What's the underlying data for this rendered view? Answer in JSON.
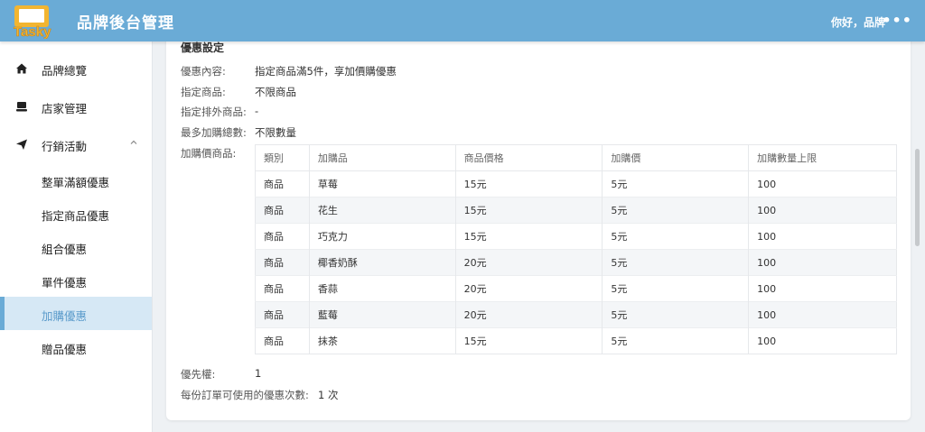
{
  "header": {
    "logo_text": "Tasky",
    "title": "品牌後台管理",
    "greeting": "你好，品牌",
    "more": "•••"
  },
  "sidebar": {
    "items": [
      {
        "label": "品牌總覽",
        "icon": "home-icon"
      },
      {
        "label": "店家管理",
        "icon": "store-icon"
      },
      {
        "label": "行銷活動",
        "icon": "send-icon",
        "expanded": true
      }
    ],
    "sub_items": [
      {
        "label": "整單滿額優惠"
      },
      {
        "label": "指定商品優惠"
      },
      {
        "label": "組合優惠"
      },
      {
        "label": "單件優惠"
      },
      {
        "label": "加購優惠",
        "active": true
      },
      {
        "label": "贈品優惠"
      }
    ]
  },
  "detail": {
    "section_title": "優惠設定",
    "content_label": "優惠內容:",
    "content_value": "指定商品滿5件，享加價購優惠",
    "products_label": "指定商品:",
    "products_value": "不限商品",
    "excluded_label": "指定排外商品:",
    "excluded_value": "-",
    "max_label": "最多加購總數:",
    "max_value": "不限數量",
    "addon_label": "加購價商品:",
    "priority_label": "優先權:",
    "priority_value": "1",
    "usage_label": "每份訂單可使用的優惠次數:",
    "usage_value": "1 次"
  },
  "table": {
    "headers": [
      "類別",
      "加購品",
      "商品價格",
      "加購價",
      "加購數量上限"
    ],
    "rows": [
      [
        "商品",
        "草莓",
        "15元",
        "5元",
        "100"
      ],
      [
        "商品",
        "花生",
        "15元",
        "5元",
        "100"
      ],
      [
        "商品",
        "巧克力",
        "15元",
        "5元",
        "100"
      ],
      [
        "商品",
        "椰香奶酥",
        "20元",
        "5元",
        "100"
      ],
      [
        "商品",
        "香蒜",
        "20元",
        "5元",
        "100"
      ],
      [
        "商品",
        "藍莓",
        "20元",
        "5元",
        "100"
      ],
      [
        "商品",
        "抹茶",
        "15元",
        "5元",
        "100"
      ]
    ]
  },
  "colors": {
    "header_bg": "#6aabd6",
    "active_bg": "#d6e8f5",
    "logo_yellow": "#f2b531"
  }
}
